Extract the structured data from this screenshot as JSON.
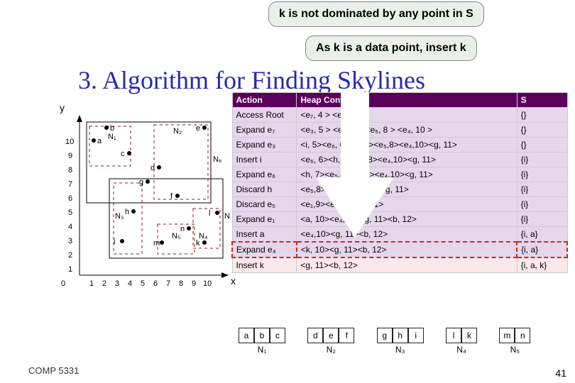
{
  "callout1": "k is not dominated by any point in S",
  "callout2": "As k is a data point, insert k",
  "title": "3. Algorithm for Finding Skylines",
  "table": {
    "headers": [
      "Action",
      "Heap Contents",
      "S"
    ],
    "rows": [
      {
        "action": "Access Root",
        "heap": "<e₇, 4 > <e₆, 6 >",
        "s": "{}"
      },
      {
        "action": "Expand e₇",
        "heap": "<e₃, 5 > <e₆, 6 > <e₅, 8 > <e₄, 10 >",
        "s": "{}"
      },
      {
        "action": "Expand e₃",
        "heap": "<i, 5><e₆, 6><h, 7><e₅,8><e₄,10><g, 11>",
        "s": "{}"
      },
      {
        "action": "Insert i",
        "heap": "<e₆, 6><h, 7><e₅,8><e₄,10><g, 11>",
        "s": "{i}"
      },
      {
        "action": "Expand e₆",
        "heap": "<h, 7><e₅,8><e₁,9><e₄,10><g, 11>",
        "s": "{i}"
      },
      {
        "action": "Discard h",
        "heap": "<e₅,8><e₁,9><e₄,10><g, 11>",
        "s": "{i}"
      },
      {
        "action": "Discard e₅",
        "heap": "<e₁,9><e₄,10><g, 11>",
        "s": "{i}"
      },
      {
        "action": "Expand e₁",
        "heap": "<a, 10><e₄,10><g, 11><b, 12>",
        "s": "{i}"
      },
      {
        "action": "Insert a",
        "heap": "<e₄,10><g, 11><b, 12>",
        "s": "{i, a}"
      },
      {
        "action": "Expand e₄",
        "heap": "<k, 10><g, 11><b, 12>",
        "s": "{i, a}"
      },
      {
        "action": "Insert k",
        "heap": "<g, 11><b, 12>",
        "s": "{i, a, k}"
      }
    ]
  },
  "leaves": [
    {
      "cells": [
        "a",
        "b",
        "c"
      ],
      "label": "N₁"
    },
    {
      "cells": [
        "d",
        "e",
        "f"
      ],
      "label": "N₂"
    },
    {
      "cells": [
        "g",
        "h",
        "i"
      ],
      "label": "N₃"
    },
    {
      "cells": [
        "l",
        "k"
      ],
      "label": "N₄"
    },
    {
      "cells": [
        "m",
        "n"
      ],
      "label": "N₅"
    }
  ],
  "chart": {
    "ylabel": "y",
    "xlabel": "x",
    "points": {
      "a": {
        "x": 1,
        "y": 9
      },
      "b": {
        "x": 2,
        "y": 10
      },
      "c": {
        "x": 4,
        "y": 8
      },
      "d": {
        "x": 6,
        "y": 7
      },
      "e": {
        "x": 9,
        "y": 10
      },
      "f": {
        "x": 7,
        "y": 5
      },
      "g": {
        "x": 5,
        "y": 6
      },
      "h": {
        "x": 4,
        "y": 4
      },
      "i": {
        "x": 3,
        "y": 2
      },
      "k": {
        "x": 9,
        "y": 2
      },
      "l": {
        "x": 10,
        "y": 4
      },
      "m": {
        "x": 6,
        "y": 2
      },
      "n": {
        "x": 8,
        "y": 3
      }
    },
    "xticks": [
      1,
      2,
      3,
      4,
      5,
      6,
      7,
      8,
      9,
      10
    ],
    "yticks": [
      1,
      2,
      3,
      4,
      5,
      6,
      7,
      8,
      9,
      10
    ],
    "nlabels": [
      "N₁",
      "N₂",
      "N₃",
      "N₄",
      "N₅",
      "N₆",
      "N₇"
    ]
  },
  "footer": "COMP 5331",
  "slidenum": "41"
}
